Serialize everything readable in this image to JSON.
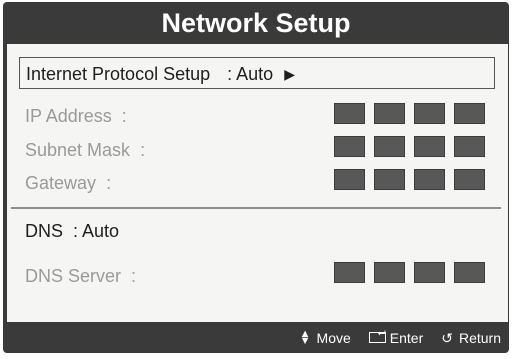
{
  "title": "Network Setup",
  "internet_protocol": {
    "label": "Internet Protocol Setup",
    "value": ": Auto"
  },
  "fields": [
    {
      "label": "IP Address",
      "sep": ":"
    },
    {
      "label": "Subnet Mask",
      "sep": ":"
    },
    {
      "label": "Gateway",
      "sep": ":"
    }
  ],
  "dns": {
    "label": "DNS",
    "value": ": Auto"
  },
  "dns_server": {
    "label": "DNS Server",
    "sep": ":"
  },
  "footer": {
    "move": "Move",
    "enter": "Enter",
    "return": "Return"
  },
  "icons": [
    "right-arrow-icon",
    "up-down-icon",
    "enter-icon",
    "return-icon"
  ]
}
